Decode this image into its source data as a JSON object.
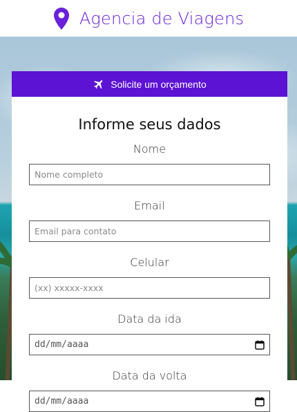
{
  "header": {
    "brand_title": "Agencia de Viagens",
    "icon": "map-pin-icon",
    "accent_color": "#6a1fd8"
  },
  "card": {
    "header_label": "Solicite um orçamento",
    "header_icon": "airplane-icon",
    "header_color": "#5c13d3",
    "form_title": "Informe seus dados"
  },
  "fields": {
    "name": {
      "label": "Nome",
      "placeholder": "Nome completo"
    },
    "email": {
      "label": "Email",
      "placeholder": "Email para contato"
    },
    "phone": {
      "label": "Celular",
      "placeholder": "(xx) xxxxx-xxxx"
    },
    "departure": {
      "label": "Data da ida",
      "placeholder": "dd/mm/aaaa",
      "icon": "calendar-icon"
    },
    "return": {
      "label": "Data da volta",
      "placeholder": "dd/mm/aaaa",
      "icon": "calendar-icon"
    }
  }
}
